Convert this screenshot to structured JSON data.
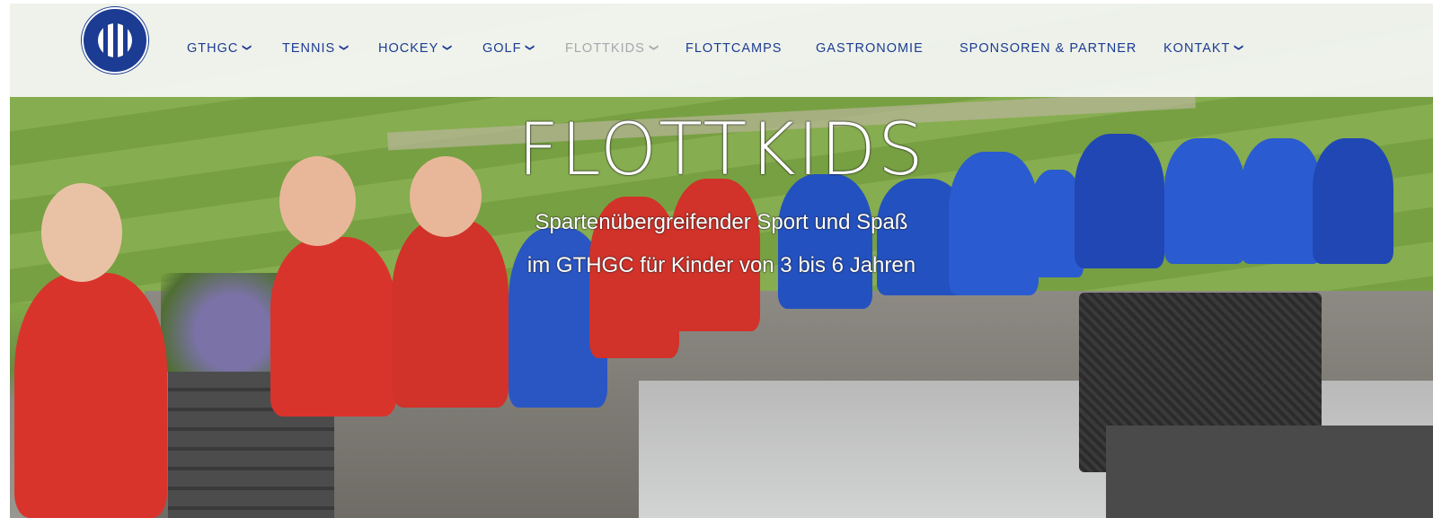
{
  "nav": {
    "items": [
      {
        "label": "GTHGC",
        "has_dropdown": true
      },
      {
        "label": "TENNIS",
        "has_dropdown": true
      },
      {
        "label": "HOCKEY",
        "has_dropdown": true
      },
      {
        "label": "GOLF",
        "has_dropdown": true
      },
      {
        "label": "FLOTTKIDS",
        "has_dropdown": true,
        "active": true
      },
      {
        "label": "FLOTTCAMPS",
        "has_dropdown": false
      },
      {
        "label": "GASTRONOMIE",
        "has_dropdown": false
      },
      {
        "label": "SPONSOREN & PARTNER",
        "has_dropdown": false
      },
      {
        "label": "KONTAKT",
        "has_dropdown": true
      }
    ],
    "dropdown_icon": "chevron-down-icon"
  },
  "hero": {
    "title": "FLOTTKIDS",
    "subtitle_line1": "Spartenübergreifender Sport und Spaß",
    "subtitle_line2": "im GTHGC für Kinder von 3 bis 6 Jahren"
  },
  "colors": {
    "nav_text": "#1c3b93",
    "nav_active": "#a5a8ab",
    "brand_blue": "#1c3b93"
  }
}
